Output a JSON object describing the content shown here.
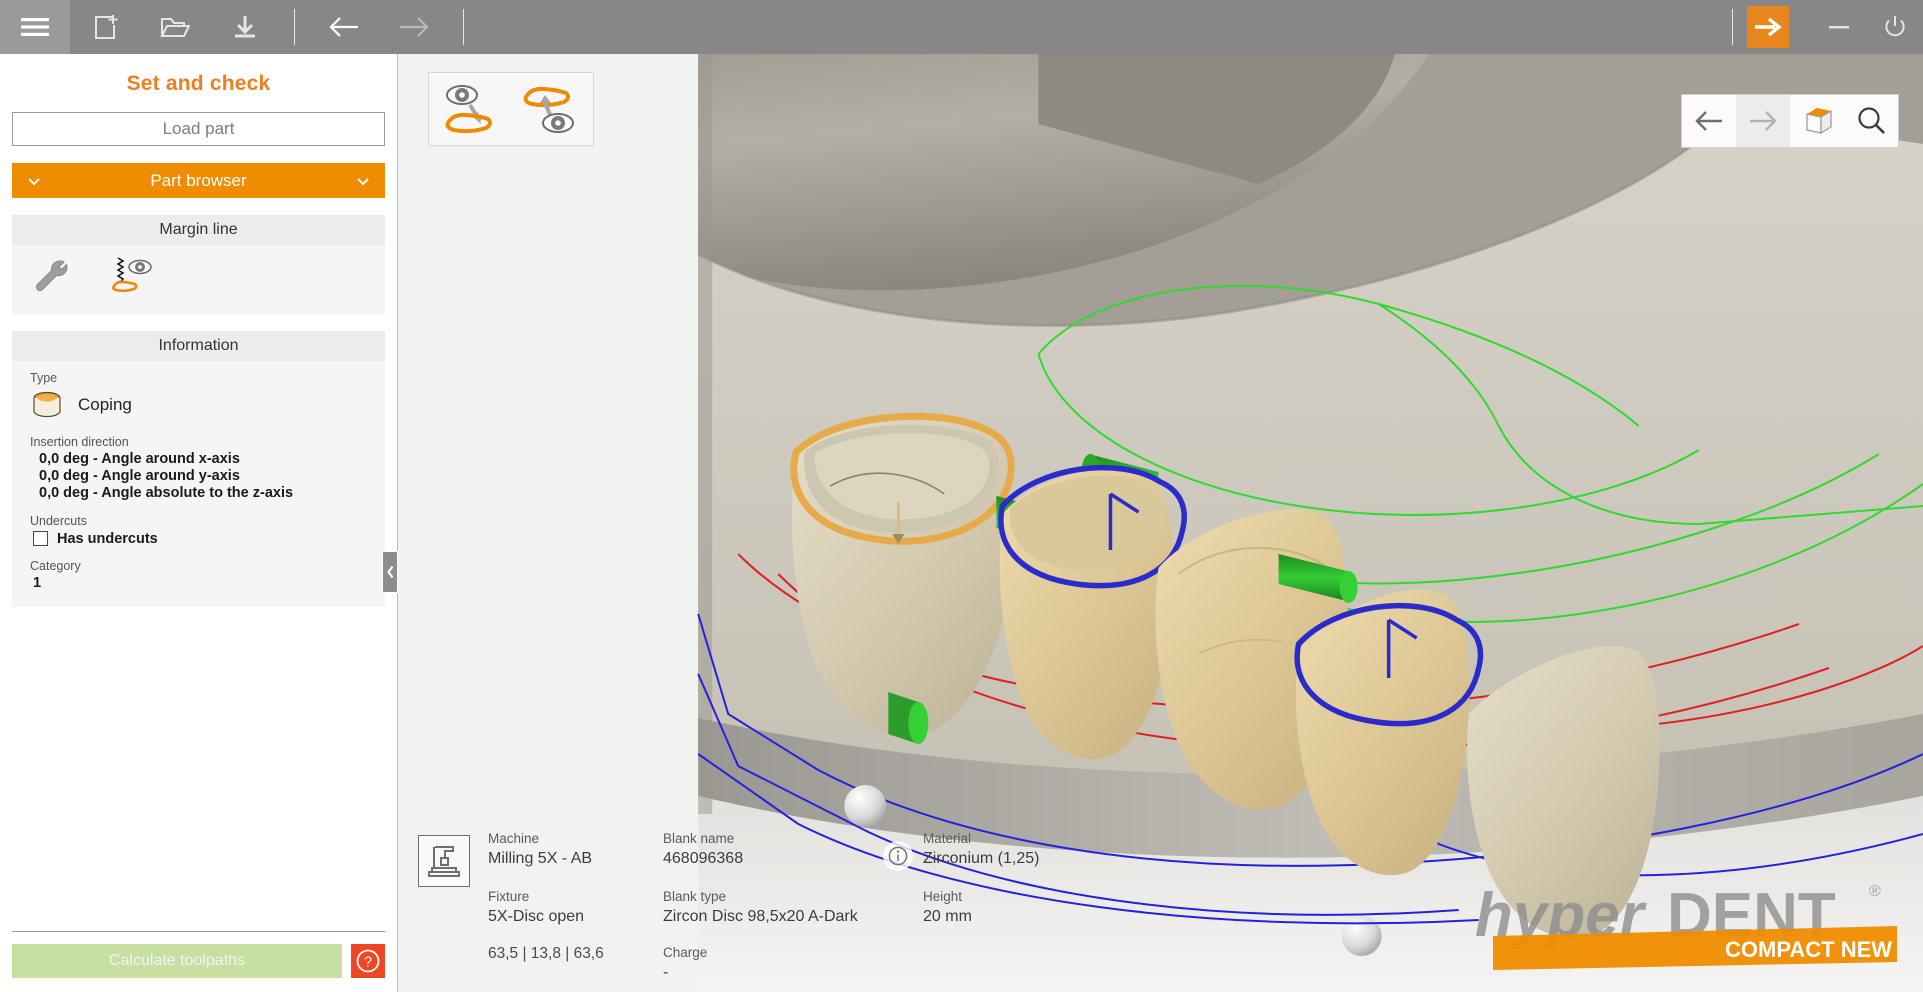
{
  "window": {
    "topbar": {
      "menu_icon": "hamburger-menu-icon",
      "new_icon": "new-document-icon",
      "open_icon": "open-folder-icon",
      "save_icon": "save-download-icon",
      "back_icon": "arrow-left-icon",
      "forward_icon": "arrow-right-icon",
      "next_label": "next-step-arrow",
      "minimize_label": "minimize",
      "power_label": "power-exit"
    }
  },
  "sidebar": {
    "title": "Set and check",
    "load_part": "Load part",
    "part_browser": "Part browser",
    "margin_line": {
      "header": "Margin line",
      "tools": [
        {
          "name": "margin-line-settings",
          "icon": "wrench-icon"
        },
        {
          "name": "margin-line-preview",
          "icon": "edit-margin-eye-icon"
        }
      ]
    },
    "information": {
      "header": "Information",
      "type_label": "Type",
      "type_value": "Coping",
      "insertion_label": "Insertion direction",
      "insertion_values": [
        "0,0 deg - Angle around x-axis",
        "0,0 deg - Angle around y-axis",
        "0,0 deg - Angle absolute to the z-axis"
      ],
      "undercuts_label": "Undercuts",
      "undercuts_checkbox": "Has undercuts",
      "undercuts_checked": false,
      "category_label": "Category",
      "category_value": "1"
    },
    "footer": {
      "calculate": "Calculate toolpaths",
      "help": "?"
    },
    "collapse": "‹"
  },
  "viewport": {
    "top_left_tools": [
      {
        "name": "view-from-above-icon"
      },
      {
        "name": "view-from-below-icon"
      }
    ],
    "top_right_tools": [
      {
        "name": "nav-back-icon"
      },
      {
        "name": "nav-forward-icon"
      },
      {
        "name": "fit-view-cube-icon"
      },
      {
        "name": "zoom-magnifier-icon"
      }
    ],
    "info": {
      "machine_label": "Machine",
      "machine_value": "Milling 5X - AB",
      "blank_name_label": "Blank name",
      "blank_name_value": "468096368",
      "material_label": "Material",
      "material_value": "Zirconium (1,25)",
      "fixture_label": "Fixture",
      "fixture_value": "5X-Disc open",
      "blank_type_label": "Blank type",
      "blank_type_value": "Zircon Disc 98,5x20 A-Dark",
      "height_label": "Height",
      "height_value": "20 mm",
      "charge_label": "Charge",
      "charge_value": "-",
      "coordinates": "63,5  | 13,8 | 63,6",
      "info_icon": "info-circle-icon"
    },
    "watermark": {
      "brand_first": "hyper",
      "brand_second": "DENT",
      "registered": "®",
      "banner": "COMPACT NEW"
    }
  },
  "colors": {
    "accent_orange": "#ef7f1a",
    "part_browser_orange": "#f08c00",
    "topbar_gray": "#878787",
    "calc_green": "#c7dfa0",
    "help_red": "#ef4623",
    "margin_orange": "#e8a33d",
    "margin_blue": "#2a2ad0",
    "pin_green": "#2fb62f",
    "curve_red": "#e02020",
    "curve_green": "#22cc22",
    "curve_blue": "#2020e0"
  }
}
